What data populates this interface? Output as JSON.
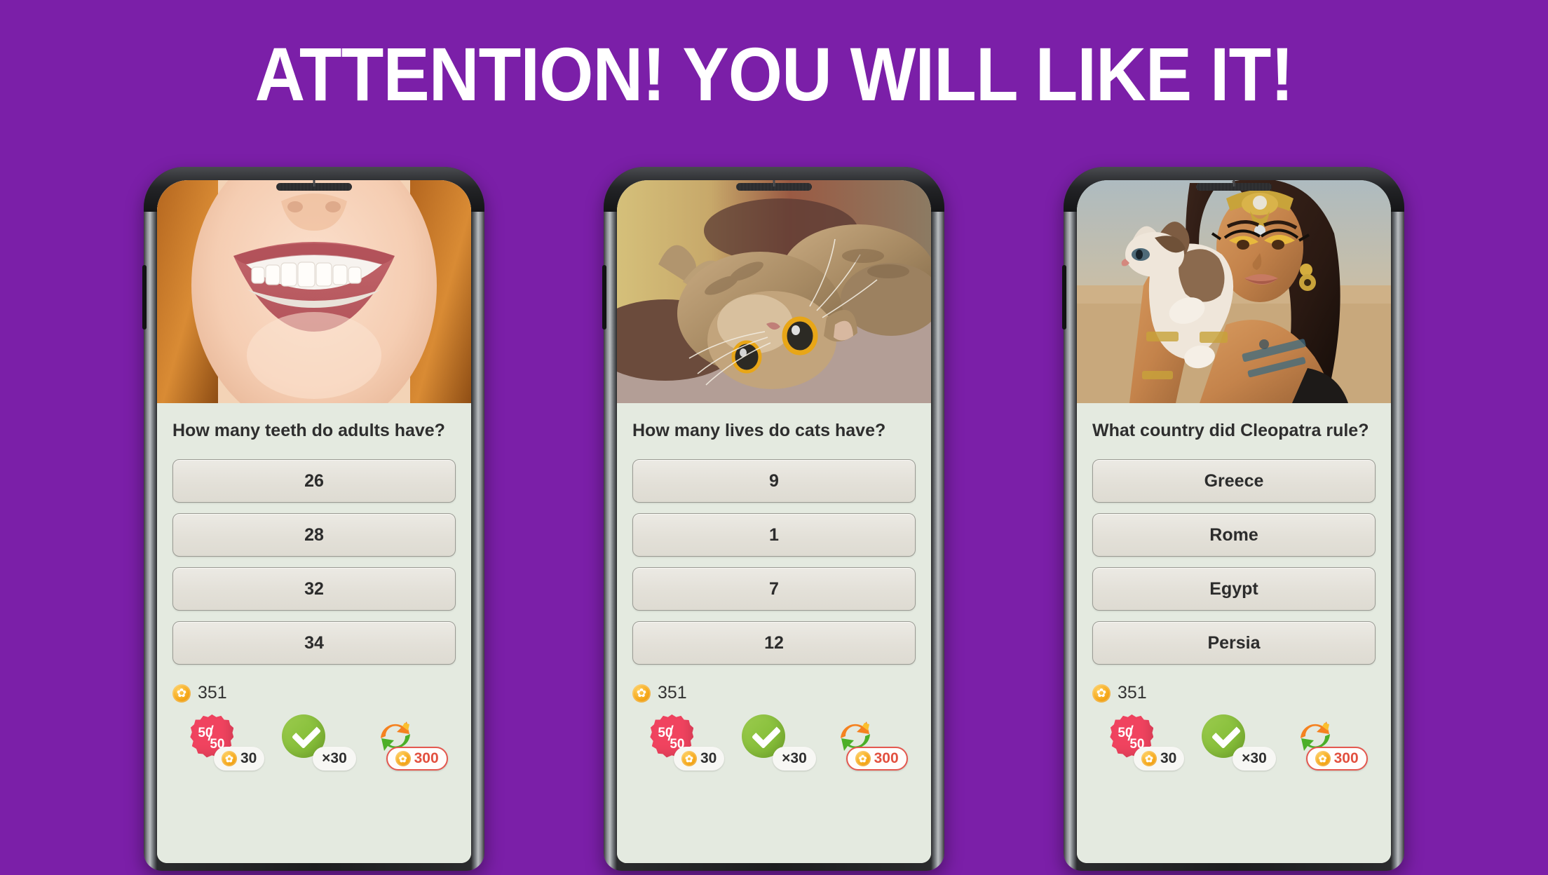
{
  "headline": "ATTENTION! YOU WILL LIKE IT!",
  "theme": {
    "background": "#7b1fa8",
    "headline_color": "#ffffff",
    "screen_background": "#e4eae0",
    "answer_text": "#2c2c2c",
    "coin_color": "#f5a719",
    "badge_5050_color": "#f0435f",
    "check_color": "#8cc23f",
    "refresh_orange": "#f58220",
    "refresh_green": "#4caf28",
    "pill_outline": "#e4584f"
  },
  "phones": [
    {
      "image_alt": "close-up of a smiling woman's mouth with white teeth",
      "question": "How many teeth do adults have?",
      "answers": [
        "26",
        "28",
        "32",
        "34"
      ],
      "coins": "351",
      "powerups": [
        {
          "icon": "fifty-fifty-icon",
          "label_top": "50",
          "label_bottom": "50",
          "cost": "30",
          "cost_type": "coin"
        },
        {
          "icon": "check-icon",
          "cost": "×30",
          "cost_type": "count"
        },
        {
          "icon": "refresh-icon",
          "cost": "300",
          "cost_type": "coin-outlined"
        }
      ]
    },
    {
      "image_alt": "tabby cat lying on its back on a couch",
      "question": "How many lives do cats have?",
      "answers": [
        "9",
        "1",
        "7",
        "12"
      ],
      "coins": "351",
      "powerups": [
        {
          "icon": "fifty-fifty-icon",
          "label_top": "50",
          "label_bottom": "50",
          "cost": "30",
          "cost_type": "coin"
        },
        {
          "icon": "check-icon",
          "cost": "×30",
          "cost_type": "count"
        },
        {
          "icon": "refresh-icon",
          "cost": "300",
          "cost_type": "coin-outlined"
        }
      ]
    },
    {
      "image_alt": "woman dressed as Cleopatra holding a cat in the desert",
      "question": "What country did Cleopatra rule?",
      "answers": [
        "Greece",
        "Rome",
        "Egypt",
        "Persia"
      ],
      "coins": "351",
      "powerups": [
        {
          "icon": "fifty-fifty-icon",
          "label_top": "50",
          "label_bottom": "50",
          "cost": "30",
          "cost_type": "coin"
        },
        {
          "icon": "check-icon",
          "cost": "×30",
          "cost_type": "count"
        },
        {
          "icon": "refresh-icon",
          "cost": "300",
          "cost_type": "coin-outlined"
        }
      ]
    }
  ]
}
